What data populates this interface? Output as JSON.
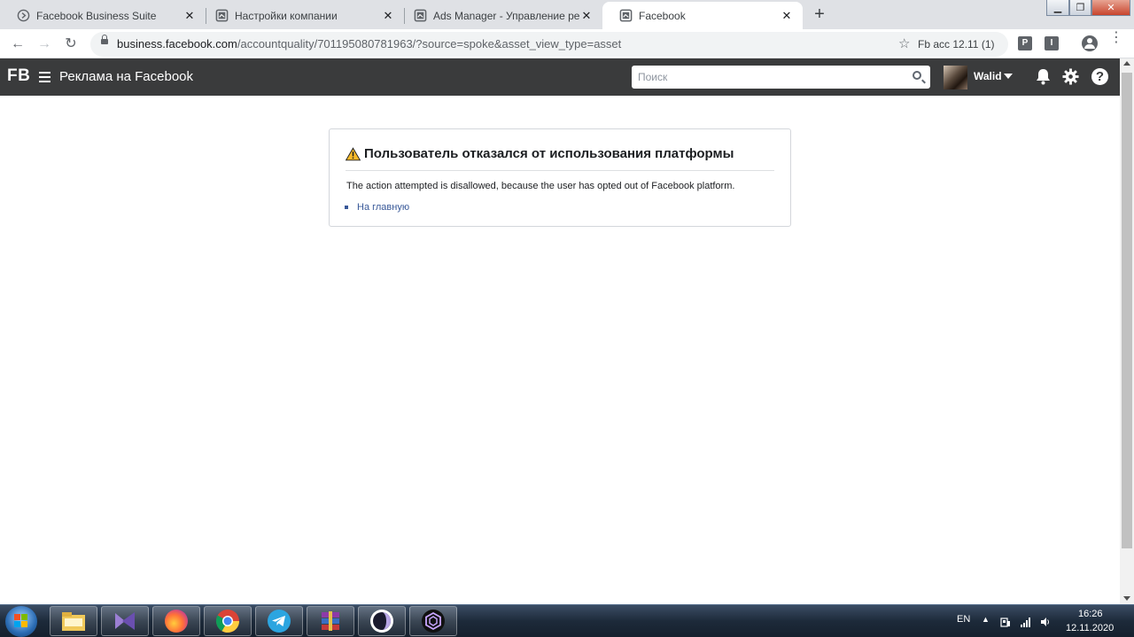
{
  "browser": {
    "tabs": [
      {
        "title": "Facebook Business Suite",
        "active": false
      },
      {
        "title": "Настройки компании",
        "active": false
      },
      {
        "title": "Ads Manager - Управление рек",
        "active": false
      },
      {
        "title": "Facebook",
        "active": true
      }
    ],
    "new_tab_icon": "plus-icon",
    "url_host": "business.facebook.com",
    "url_path": "/accountquality/701195080781963/?source=spoke&asset_view_type=asset",
    "profile_chip": "Fb acc 12.11 (1)",
    "extensions": [
      "P",
      "I"
    ]
  },
  "fb": {
    "logo": "FB",
    "title": "Реклама на Facebook",
    "search_placeholder": "Поиск",
    "user_name": "Walid",
    "header_bg": "#3a3b3c"
  },
  "error": {
    "title": "Пользователь отказался от использования платформы",
    "message": "The action attempted is disallowed, because the user has opted out of Facebook platform.",
    "link": "На главную",
    "link_color": "#385898"
  },
  "taskbar": {
    "language": "EN",
    "time": "16:26",
    "date": "12.11.2020"
  }
}
